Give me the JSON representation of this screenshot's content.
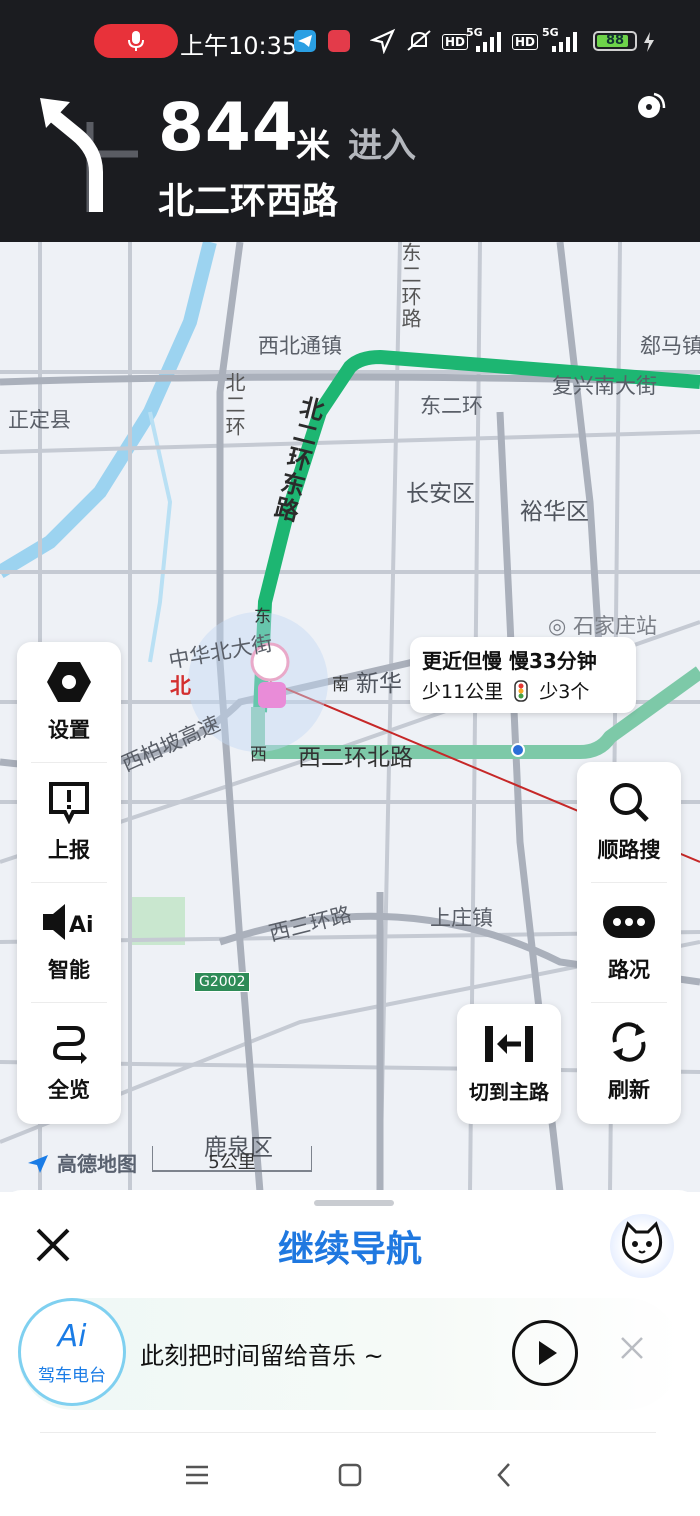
{
  "status": {
    "time": "上午10:35",
    "net1": "5G",
    "hd1": "HD",
    "net2": "5G",
    "hd2": "HD",
    "battery_pct": 88,
    "battery_label": "88"
  },
  "navigation": {
    "distance": "844",
    "unit": "米",
    "action": "进入",
    "road": "北二环西路"
  },
  "map": {
    "labels": [
      "西北通镇",
      "东二环",
      "复兴南大街",
      "郄马镇",
      "正定县",
      "长安区",
      "裕华区",
      "石家庄站",
      "新华",
      "西二环北路",
      "西三环路",
      "上庄镇",
      "鹿泉区",
      "中华北大街",
      "西柏坡高速",
      "北",
      "南",
      "东",
      "西",
      "G2002",
      "北二环",
      "东二环路"
    ],
    "vertical_labels": {
      "north_east_ring": "北二环东路",
      "north_ring_small": "北二环",
      "east_ring_small": "东二环路"
    },
    "route_bubble": {
      "line1": "更近但慢 慢33分钟",
      "line2a": "少11公里",
      "line2b": "少3个"
    },
    "logo": "高德地图",
    "scale": "5公里",
    "left_buttons": [
      {
        "label": "设置",
        "icon": "hexagon-settings-icon"
      },
      {
        "label": "上报",
        "icon": "report-icon"
      },
      {
        "label": "智能",
        "icon": "ai-voice-icon"
      },
      {
        "label": "全览",
        "icon": "overview-route-icon"
      }
    ],
    "right_buttons": [
      {
        "label": "顺路搜",
        "icon": "search-icon"
      },
      {
        "label": "路况",
        "icon": "traffic-icon"
      },
      {
        "label": "刷新",
        "icon": "refresh-icon"
      }
    ],
    "switch_button": {
      "label": "切到主路",
      "icon": "switch-main-road-icon"
    }
  },
  "sheet": {
    "continue_label": "继续导航",
    "radio": {
      "badge_top": "Ai",
      "badge_bottom": "驾车电台",
      "text": "此刻把时间留给音乐 ~"
    }
  },
  "colors": {
    "route_green": "#1db672",
    "accent_blue": "#1f78e0",
    "header_bg": "#1b1c20"
  }
}
